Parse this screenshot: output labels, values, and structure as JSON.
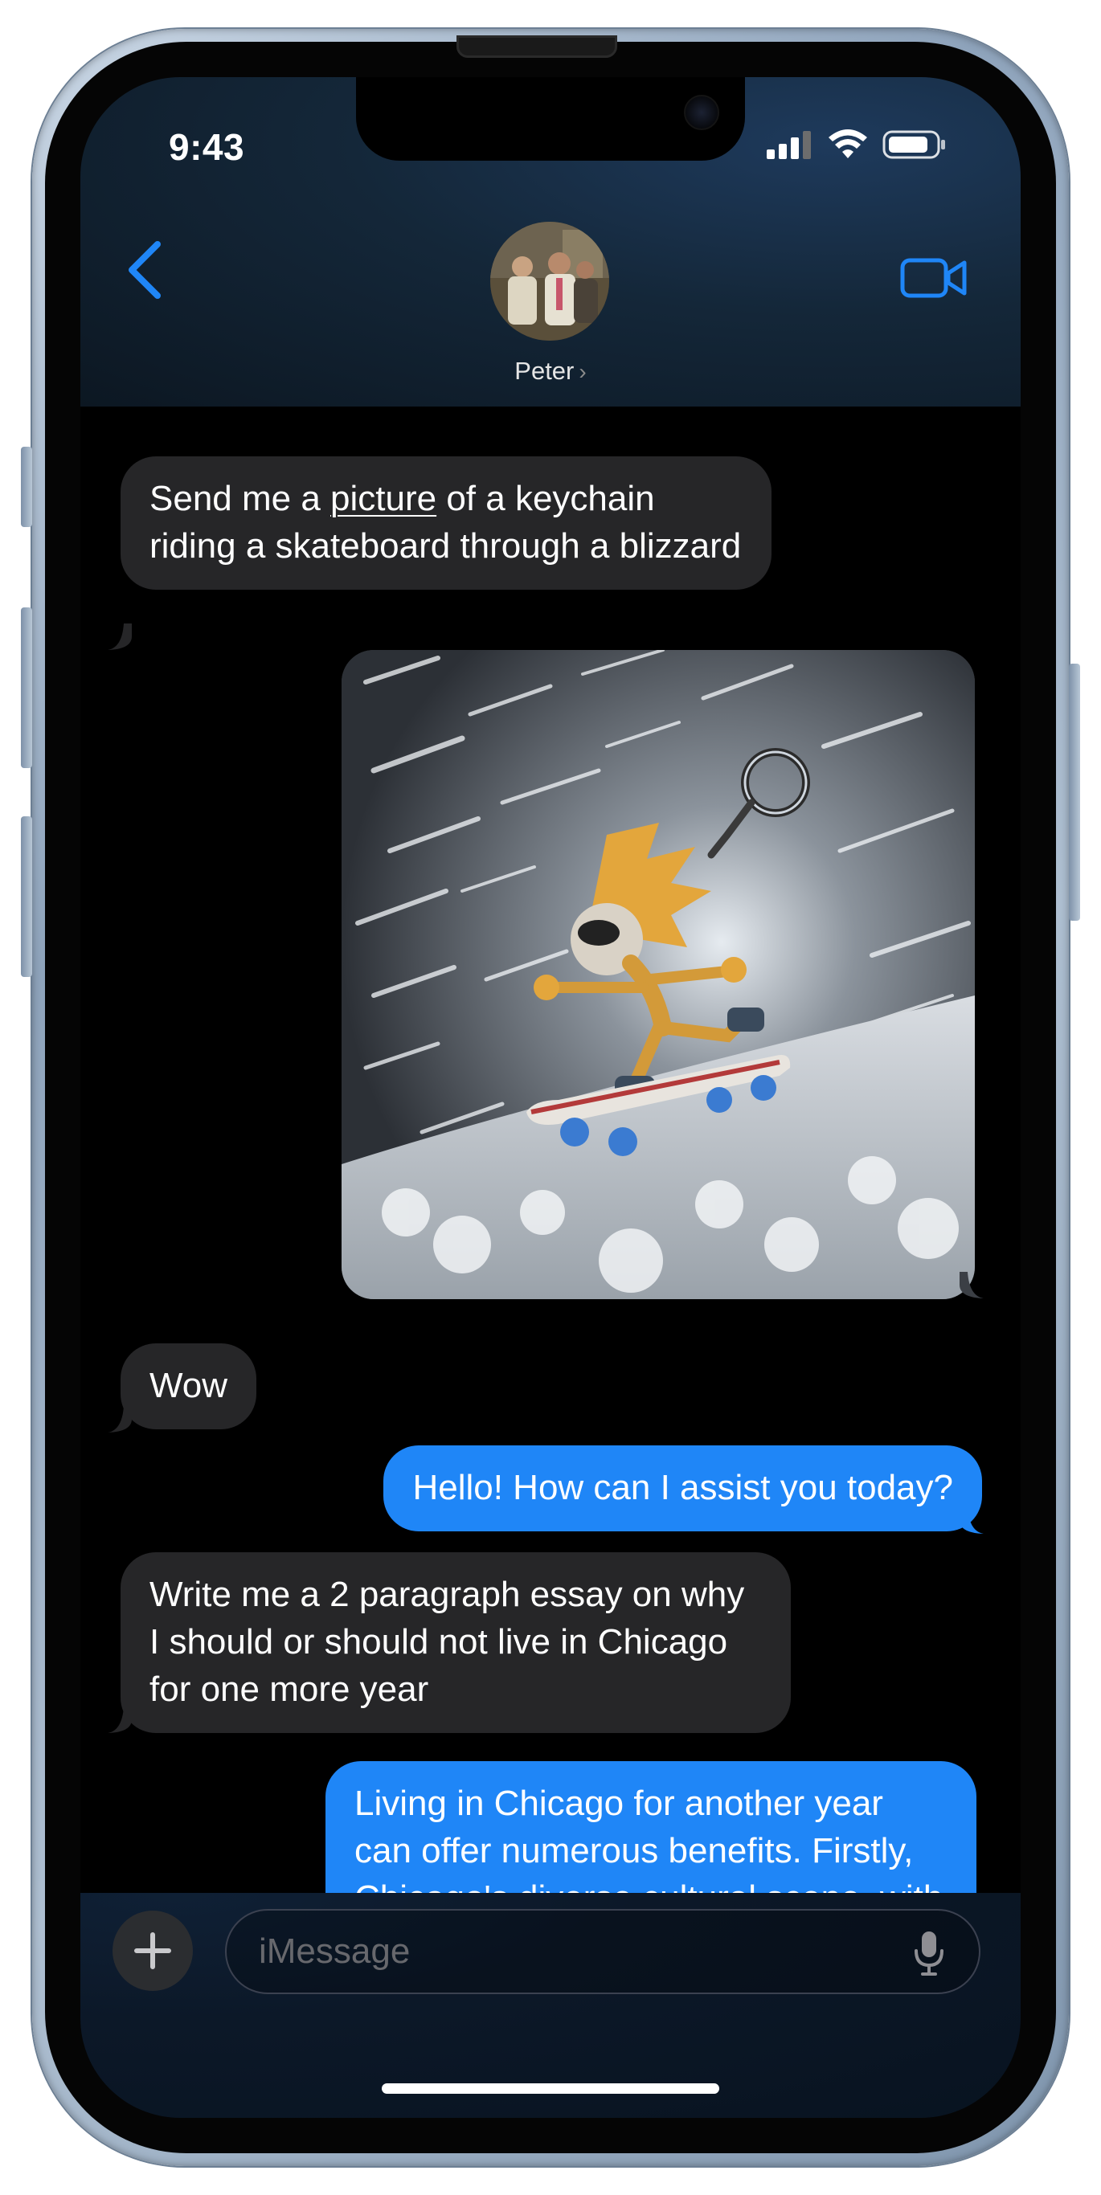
{
  "status": {
    "time": "9:43"
  },
  "header": {
    "contact_name": "Peter",
    "name_chevron": "›"
  },
  "messages": [
    {
      "sender": "received",
      "text_before_link": "Send me a ",
      "link_text": "picture",
      "text_after_link": " of a keychain riding a skateboard through a blizzard"
    },
    {
      "sender": "sent",
      "type": "image",
      "image_alt": "keychain riding a skateboard through a blizzard"
    },
    {
      "sender": "received",
      "text": "Wow"
    },
    {
      "sender": "sent",
      "text": "Hello! How can I assist you today?"
    },
    {
      "sender": "received",
      "text": "Write me a 2 paragraph essay on why I should or should not live in Chicago for one more year"
    },
    {
      "sender": "sent",
      "text": "Living in Chicago for another year can offer numerous benefits. Firstly, Chicago's diverse cultural scene, with its multitude of"
    }
  ],
  "composer": {
    "placeholder": "iMessage",
    "plus_icon": "plus-icon",
    "mic_icon": "microphone-icon"
  },
  "colors": {
    "accent": "#1f86f7",
    "received_bubble": "#262628",
    "background": "#000000"
  }
}
